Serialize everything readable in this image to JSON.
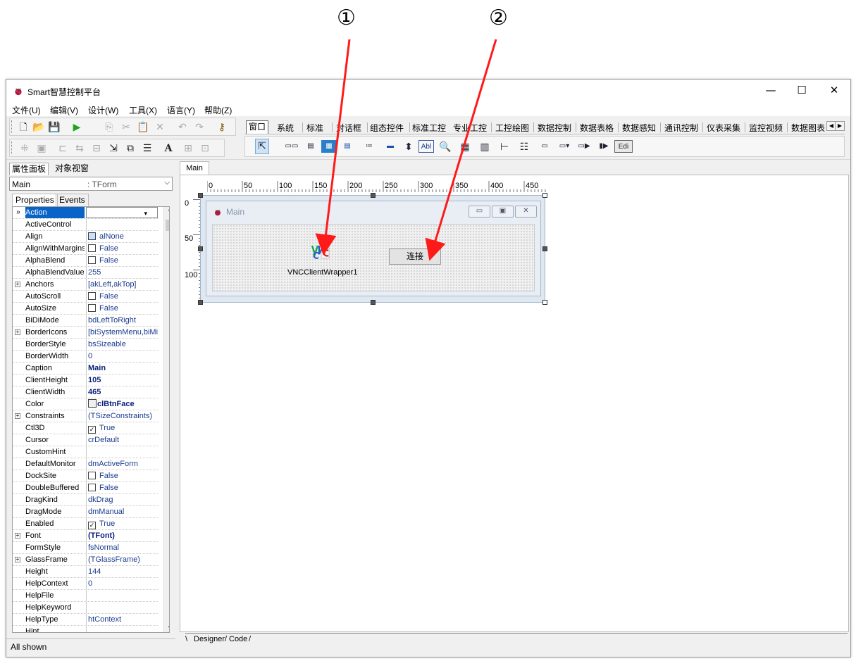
{
  "annotations": {
    "first": "①",
    "second": "②"
  },
  "window": {
    "title": "Smart智慧控制平台",
    "min_glyph": "—",
    "max_glyph": "☐",
    "close_glyph": "✕"
  },
  "menu": [
    "文件(U)",
    "编辑(V)",
    "设计(W)",
    "工具(X)",
    "语言(Y)",
    "帮助(Z)"
  ],
  "palette": {
    "tabs": [
      "窗口",
      "系统",
      "标准",
      "对话框",
      "组态控件",
      "标准工控",
      "专业工控",
      "工控绘图",
      "数据控制",
      "数据表格",
      "数据感知",
      "通讯控制",
      "仪表采集",
      "监控视频",
      "数据图表"
    ],
    "last_icon": "Edi"
  },
  "left": {
    "tabs": [
      "属性面板",
      "对象视窗"
    ],
    "object": {
      "name": "Main",
      "type": ": TForm"
    },
    "pe_tabs": [
      "Properties",
      "Events"
    ],
    "properties": [
      {
        "name": "Action",
        "value": "",
        "kind": "dropdown",
        "selected": true
      },
      {
        "name": "ActiveControl",
        "value": ""
      },
      {
        "name": "Align",
        "value": "alNone",
        "kind": "align"
      },
      {
        "name": "AlignWithMargins",
        "value": "False",
        "kind": "check"
      },
      {
        "name": "AlphaBlend",
        "value": "False",
        "kind": "check"
      },
      {
        "name": "AlphaBlendValue",
        "value": "255"
      },
      {
        "name": "Anchors",
        "value": "[akLeft,akTop]",
        "expand": true
      },
      {
        "name": "AutoScroll",
        "value": "False",
        "kind": "check"
      },
      {
        "name": "AutoSize",
        "value": "False",
        "kind": "check"
      },
      {
        "name": "BiDiMode",
        "value": "bdLeftToRight"
      },
      {
        "name": "BorderIcons",
        "value": "[biSystemMenu,biMini",
        "expand": true
      },
      {
        "name": "BorderStyle",
        "value": "bsSizeable"
      },
      {
        "name": "BorderWidth",
        "value": "0"
      },
      {
        "name": "Caption",
        "value": "Main",
        "bold": true
      },
      {
        "name": "ClientHeight",
        "value": "105",
        "bold": true
      },
      {
        "name": "ClientWidth",
        "value": "465",
        "bold": true
      },
      {
        "name": "Color",
        "value": "clBtnFace",
        "bold": true,
        "kind": "color"
      },
      {
        "name": "Constraints",
        "value": "(TSizeConstraints)",
        "expand": true
      },
      {
        "name": "Ctl3D",
        "value": "True",
        "kind": "checked"
      },
      {
        "name": "Cursor",
        "value": "crDefault"
      },
      {
        "name": "CustomHint",
        "value": ""
      },
      {
        "name": "DefaultMonitor",
        "value": "dmActiveForm"
      },
      {
        "name": "DockSite",
        "value": "False",
        "kind": "check"
      },
      {
        "name": "DoubleBuffered",
        "value": "False",
        "kind": "check"
      },
      {
        "name": "DragKind",
        "value": "dkDrag"
      },
      {
        "name": "DragMode",
        "value": "dmManual"
      },
      {
        "name": "Enabled",
        "value": "True",
        "kind": "checked"
      },
      {
        "name": "Font",
        "value": "(TFont)",
        "bold": true,
        "expand": true
      },
      {
        "name": "FormStyle",
        "value": "fsNormal"
      },
      {
        "name": "GlassFrame",
        "value": "(TGlassFrame)",
        "expand": true
      },
      {
        "name": "Height",
        "value": "144"
      },
      {
        "name": "HelpContext",
        "value": "0"
      },
      {
        "name": "HelpFile",
        "value": ""
      },
      {
        "name": "HelpKeyword",
        "value": ""
      },
      {
        "name": "HelpType",
        "value": "htContext"
      },
      {
        "name": "Hint",
        "value": ""
      }
    ],
    "status": "All shown"
  },
  "designer": {
    "tab": "Main",
    "ruler_h": [
      "0",
      "50",
      "100",
      "150",
      "200",
      "250",
      "300",
      "350",
      "400",
      "450"
    ],
    "ruler_v": [
      "0",
      "50",
      "100"
    ],
    "form_caption": "Main",
    "vnc_label": "VNCClientWrapper1",
    "connect_label": "连接",
    "bottom_tabs": [
      "Designer",
      "Code"
    ]
  },
  "colors": {
    "arrow": "#ff1a1a",
    "selection": "#0a64c8",
    "value_text": "#1a3c8e"
  },
  "icons": [
    "new-file-icon",
    "open-folder-icon",
    "save-icon",
    "run-icon",
    "copy-icon",
    "cut-icon",
    "paste-icon",
    "delete-icon",
    "undo-icon",
    "redo-icon",
    "key-icon",
    "pointer-icon"
  ]
}
